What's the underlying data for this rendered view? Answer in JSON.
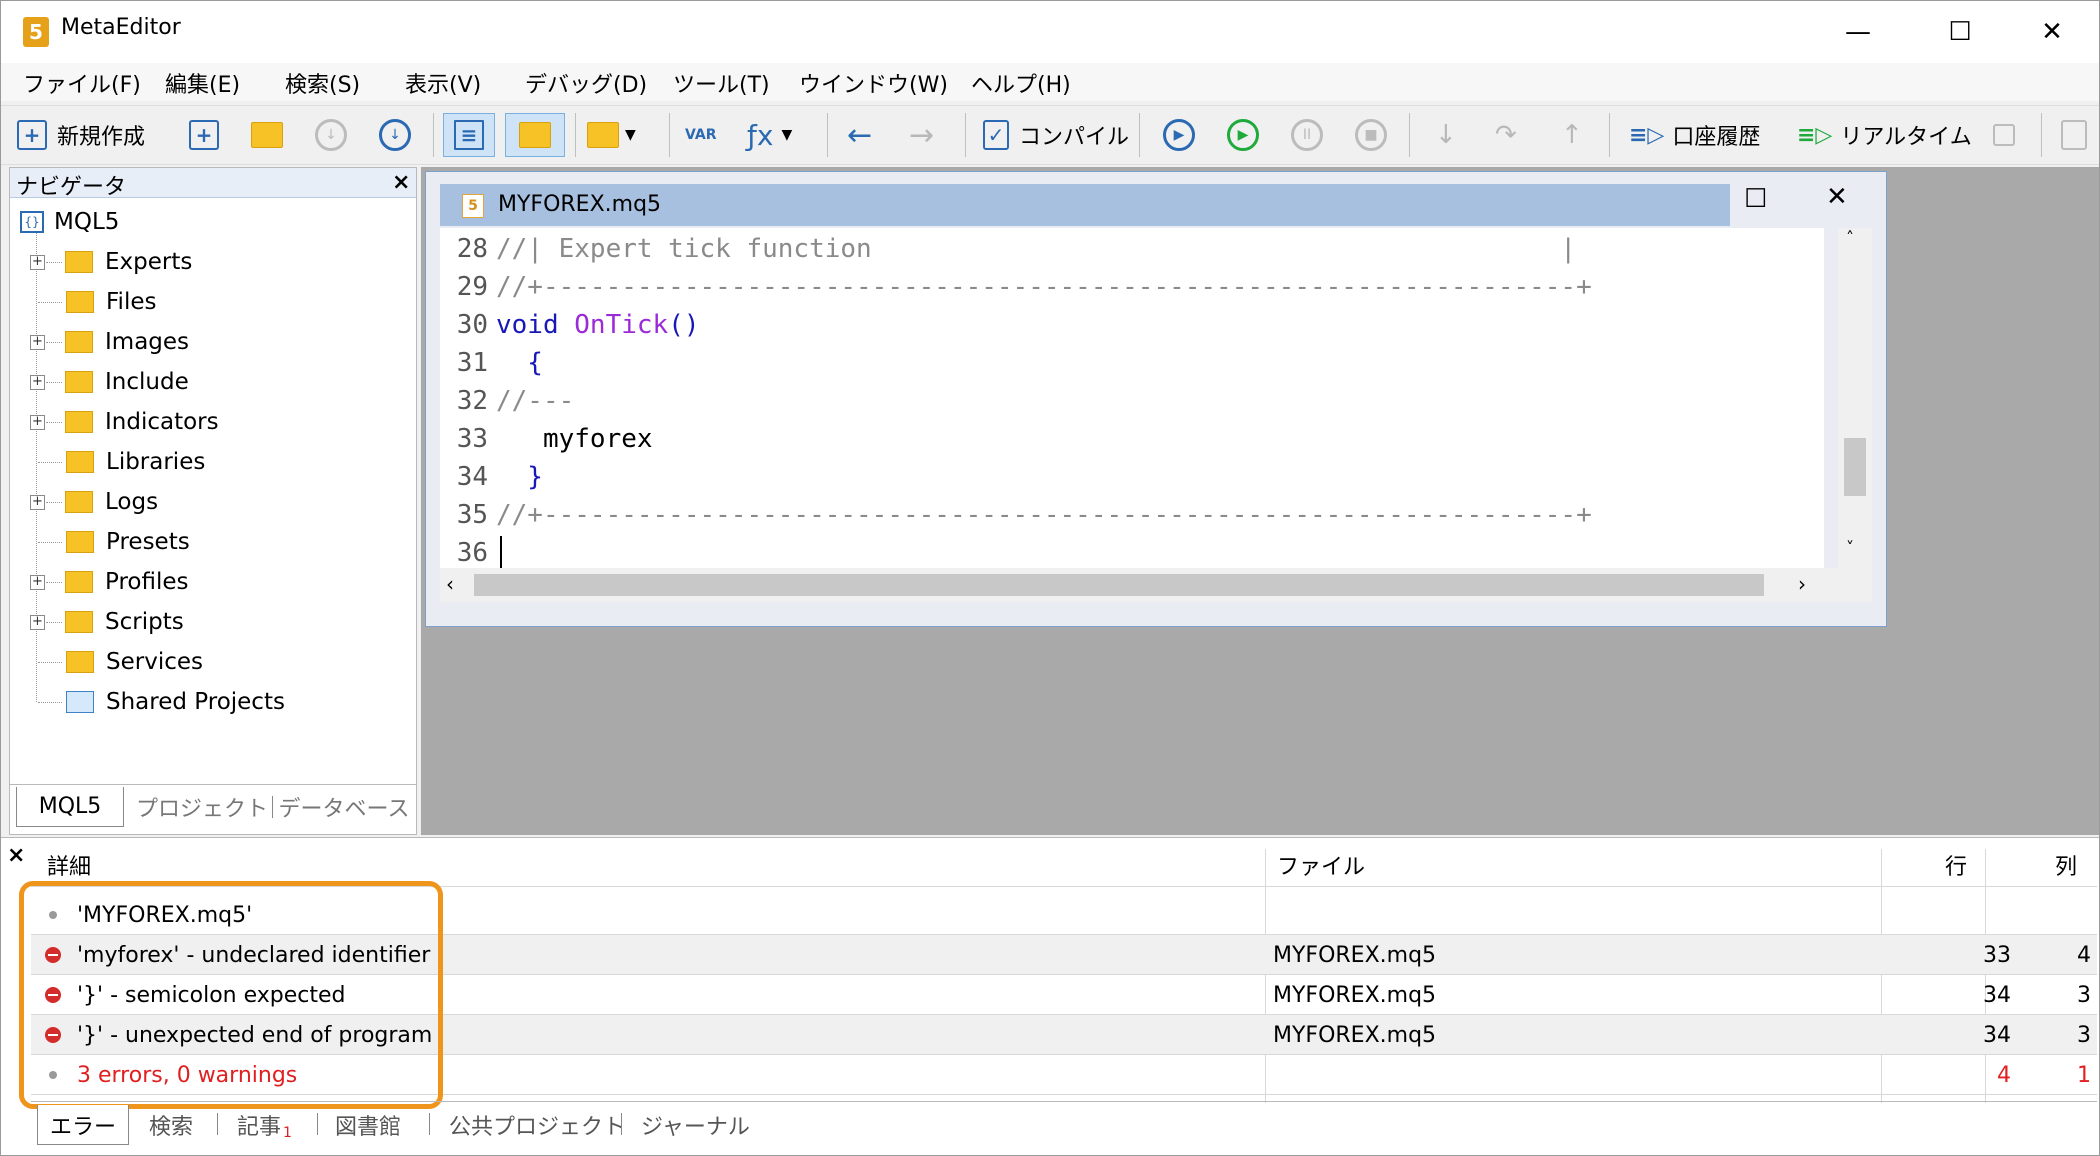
{
  "app": {
    "title": "MetaEditor"
  },
  "window_controls": {
    "minimize": "—",
    "maximize": "☐",
    "close": "✕"
  },
  "menu": [
    "ファイル(F)",
    "編集(E)",
    "検索(S)",
    "表示(V)",
    "デバッグ(D)",
    "ツール(T)",
    "ウインドウ(W)",
    "ヘルプ(H)"
  ],
  "toolbar": {
    "new_label": "新規作成",
    "compile_label": "コンパイル",
    "history_label": "口座履歴",
    "realtime_label": "リアルタイム",
    "var_label": "VAR",
    "fx_label": "ƒx"
  },
  "navigator": {
    "title": "ナビゲータ",
    "root": "MQL5",
    "items": [
      "Experts",
      "Files",
      "Images",
      "Include",
      "Indicators",
      "Libraries",
      "Logs",
      "Presets",
      "Profiles",
      "Scripts",
      "Services",
      "Shared Projects"
    ],
    "tabs": [
      "MQL5",
      "プロジェクト",
      "データベース"
    ]
  },
  "editor": {
    "tab_title": "MYFOREX.mq5",
    "tab_icon": "5",
    "lines": [
      {
        "no": "28",
        "text": "//| Expert tick function                                            |"
      },
      {
        "no": "29",
        "text": "//+------------------------------------------------------------------+"
      },
      {
        "no": "30",
        "kw": "void ",
        "fn": "OnTick",
        "rest": "()"
      },
      {
        "no": "31",
        "text": "  {"
      },
      {
        "no": "32",
        "text": "//---"
      },
      {
        "no": "33",
        "text": "   myforex"
      },
      {
        "no": "34",
        "text": "  }"
      },
      {
        "no": "35",
        "text": "//+------------------------------------------------------------------+"
      },
      {
        "no": "36",
        "text": ""
      }
    ]
  },
  "errors": {
    "columns": {
      "detail": "詳細",
      "file": "ファイル",
      "line": "行",
      "col": "列"
    },
    "rows": [
      {
        "type": "info",
        "detail": "'MYFOREX.mq5'",
        "file": "",
        "line": "",
        "col": ""
      },
      {
        "type": "error",
        "detail": "'myforex' - undeclared identifier",
        "file": "MYFOREX.mq5",
        "line": "33",
        "col": "4"
      },
      {
        "type": "error",
        "detail": "'}' - semicolon expected",
        "file": "MYFOREX.mq5",
        "line": "34",
        "col": "3"
      },
      {
        "type": "error",
        "detail": "'}' - unexpected end of program",
        "file": "MYFOREX.mq5",
        "line": "34",
        "col": "3"
      },
      {
        "type": "summary",
        "detail": "3 errors, 0 warnings",
        "file": "",
        "line": "4",
        "col": "1"
      }
    ],
    "summary_color": "#e02020"
  },
  "bottom_tabs": [
    "エラー",
    "検索",
    "記事",
    "図書館",
    "公共プロジェクト",
    "ジャーナル"
  ],
  "bottom_tab_badge": "1",
  "highlight_color": "#f0951c"
}
